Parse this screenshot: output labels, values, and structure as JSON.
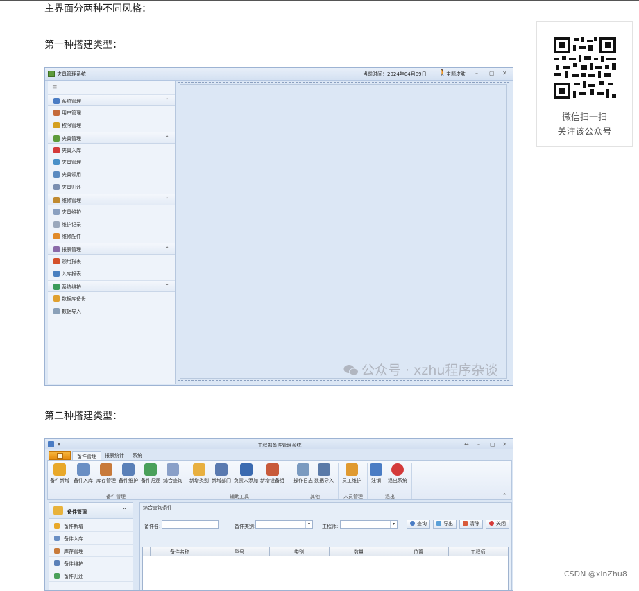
{
  "article": {
    "intro": "主界面分两种不同风格：",
    "type1": "第一种搭建类型：",
    "type2": "第二种搭建类型："
  },
  "qr": {
    "line1": "微信扫一扫",
    "line2": "关注该公众号"
  },
  "window1": {
    "title": "夹具管理系统",
    "time_label": "当前时间：",
    "time_value": "2024年04月09日",
    "skin": "主题皮肤",
    "nav": [
      {
        "type": "group",
        "label": "系统管理",
        "color": "#4a7cc4"
      },
      {
        "type": "item",
        "label": "用户管理",
        "color": "#c46a3a"
      },
      {
        "type": "item",
        "label": "权限管理",
        "color": "#d4a020"
      },
      {
        "type": "group",
        "label": "夹具管理",
        "color": "#5d9b3b"
      },
      {
        "type": "item",
        "label": "夹具入库",
        "color": "#d43a3a"
      },
      {
        "type": "item",
        "label": "夹具管理",
        "color": "#4a90c8"
      },
      {
        "type": "item",
        "label": "夹具领用",
        "color": "#5a8ac0"
      },
      {
        "type": "item",
        "label": "夹具归还",
        "color": "#7b8fb0"
      },
      {
        "type": "group",
        "label": "维修管理",
        "color": "#c08a30"
      },
      {
        "type": "item",
        "label": "夹具维护",
        "color": "#8aa0c0"
      },
      {
        "type": "item",
        "label": "维护记录",
        "color": "#9aa8bc"
      },
      {
        "type": "item",
        "label": "维修配件",
        "color": "#e08a2a"
      },
      {
        "type": "group",
        "label": "报表管理",
        "color": "#8a6aa8"
      },
      {
        "type": "item",
        "label": "领用报表",
        "color": "#d4502a"
      },
      {
        "type": "item",
        "label": "入库报表",
        "color": "#4a80c0"
      },
      {
        "type": "group",
        "label": "系统维护",
        "color": "#3a9a5a"
      },
      {
        "type": "item",
        "label": "数据库备份",
        "color": "#e0a030"
      },
      {
        "type": "item",
        "label": "数据导入",
        "color": "#8aa0b8"
      }
    ],
    "watermark": "公众号 · xzhu程序杂谈"
  },
  "window2": {
    "title": "工程部备件管理系统",
    "tabs": [
      "备件管理",
      "报表统计",
      "系统"
    ],
    "ribbon_buttons": [
      {
        "label": "备件新增",
        "color": "#e8a82a"
      },
      {
        "label": "备件入库",
        "color": "#6a8fc4"
      },
      {
        "label": "库存管理",
        "color": "#c87a3a"
      },
      {
        "label": "备件维护",
        "color": "#5a80b8"
      },
      {
        "label": "备件归还",
        "color": "#4aa05a"
      },
      {
        "label": "综合查询",
        "color": "#8aa0c8"
      },
      {
        "label": "新增类别",
        "color": "#e8b040"
      },
      {
        "label": "新增部门",
        "color": "#5a7ab0"
      },
      {
        "label": "负责人添加",
        "color": "#3a6ab0"
      },
      {
        "label": "新增设备组",
        "color": "#c85a3a"
      },
      {
        "label": "操作日志",
        "color": "#7a9ac0"
      },
      {
        "label": "数据导入",
        "color": "#5a7aa8"
      },
      {
        "label": "员工维护",
        "color": "#e09a30"
      },
      {
        "label": "注销",
        "color": "#4a7cc4"
      },
      {
        "label": "退出系统",
        "color": "#d43a3a"
      }
    ],
    "groups": [
      "备件管理",
      "辅助工具",
      "其他",
      "人员管理",
      "退出"
    ],
    "nav_header": "备件管理",
    "nav_items": [
      {
        "label": "备件新增",
        "color": "#e8a82a"
      },
      {
        "label": "备件入库",
        "color": "#6a8fc4"
      },
      {
        "label": "库存管理",
        "color": "#c87a3a"
      },
      {
        "label": "备件维护",
        "color": "#5a80b8"
      },
      {
        "label": "备件归还",
        "color": "#4aa05a"
      }
    ],
    "panel_title": "综合查询条件",
    "fields": {
      "name": "备件名:",
      "category": "备件类别:",
      "engineer": "工程师:"
    },
    "actions": {
      "query": "查询",
      "export": "导出",
      "clear": "清除",
      "close": "关闭"
    },
    "columns": [
      "备件名称",
      "型号",
      "类别",
      "数量",
      "位置",
      "工程师"
    ]
  },
  "footer": {
    "csdn": "CSDN @xinZhu8"
  }
}
